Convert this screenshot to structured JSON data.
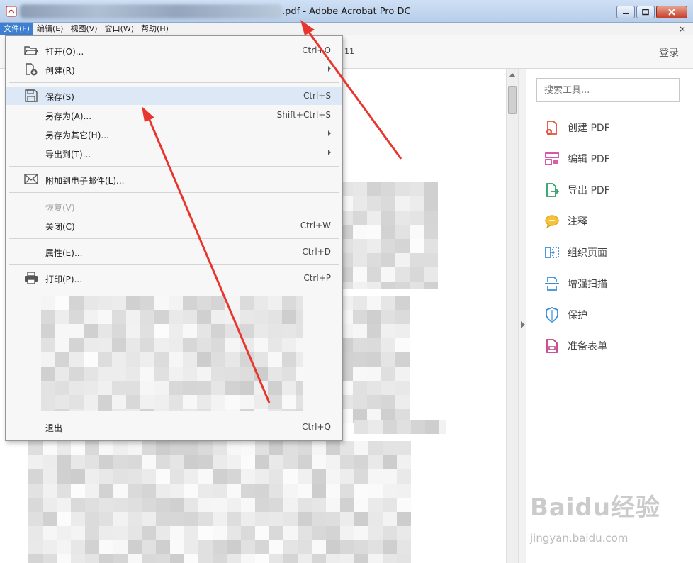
{
  "window": {
    "title_suffix": ".pdf - Adobe Acrobat Pro DC",
    "doc_close": "×"
  },
  "menubar": {
    "items": [
      "文件(F)",
      "编辑(E)",
      "视图(V)",
      "窗口(W)",
      "帮助(H)"
    ],
    "active_index": 0
  },
  "toolbar": {
    "page_num": "11",
    "login": "登录"
  },
  "file_menu": {
    "open": {
      "label": "打开(O)...",
      "shortcut": "Ctrl+O"
    },
    "create": {
      "label": "创建(R)"
    },
    "save": {
      "label": "保存(S)",
      "shortcut": "Ctrl+S"
    },
    "save_as": {
      "label": "另存为(A)...",
      "shortcut": "Shift+Ctrl+S"
    },
    "save_as_other": {
      "label": "另存为其它(H)..."
    },
    "export_to": {
      "label": "导出到(T)..."
    },
    "attach_email": {
      "label": "附加到电子邮件(L)..."
    },
    "revert": {
      "label": "恢复(V)"
    },
    "close": {
      "label": "关闭(C)",
      "shortcut": "Ctrl+W"
    },
    "properties": {
      "label": "属性(E)...",
      "shortcut": "Ctrl+D"
    },
    "print": {
      "label": "打印(P)...",
      "shortcut": "Ctrl+P"
    },
    "exit": {
      "label": "退出",
      "shortcut": "Ctrl+Q"
    }
  },
  "tools_panel": {
    "search_placeholder": "搜索工具...",
    "tools": [
      {
        "label": "创建 PDF",
        "icon": "create-pdf-icon",
        "color": "#e0513b"
      },
      {
        "label": "编辑 PDF",
        "icon": "edit-pdf-icon",
        "color": "#d2479b"
      },
      {
        "label": "导出 PDF",
        "icon": "export-pdf-icon",
        "color": "#2e9e6a"
      },
      {
        "label": "注释",
        "icon": "comment-icon",
        "color": "#e8b516"
      },
      {
        "label": "组织页面",
        "icon": "organize-pages-icon",
        "color": "#3a8fd6"
      },
      {
        "label": "增强扫描",
        "icon": "enhance-scan-icon",
        "color": "#3a8fd6"
      },
      {
        "label": "保护",
        "icon": "protect-icon",
        "color": "#3a8fd6"
      },
      {
        "label": "准备表单",
        "icon": "prepare-form-icon",
        "color": "#c43d84"
      }
    ]
  },
  "colors": {
    "menu_active": "#3d7fd0",
    "hover_row": "#dce8f6",
    "annotation_arrow": "#e8352d"
  },
  "watermark": {
    "logo": "Baidu经验",
    "url": "jingyan.baidu.com"
  }
}
